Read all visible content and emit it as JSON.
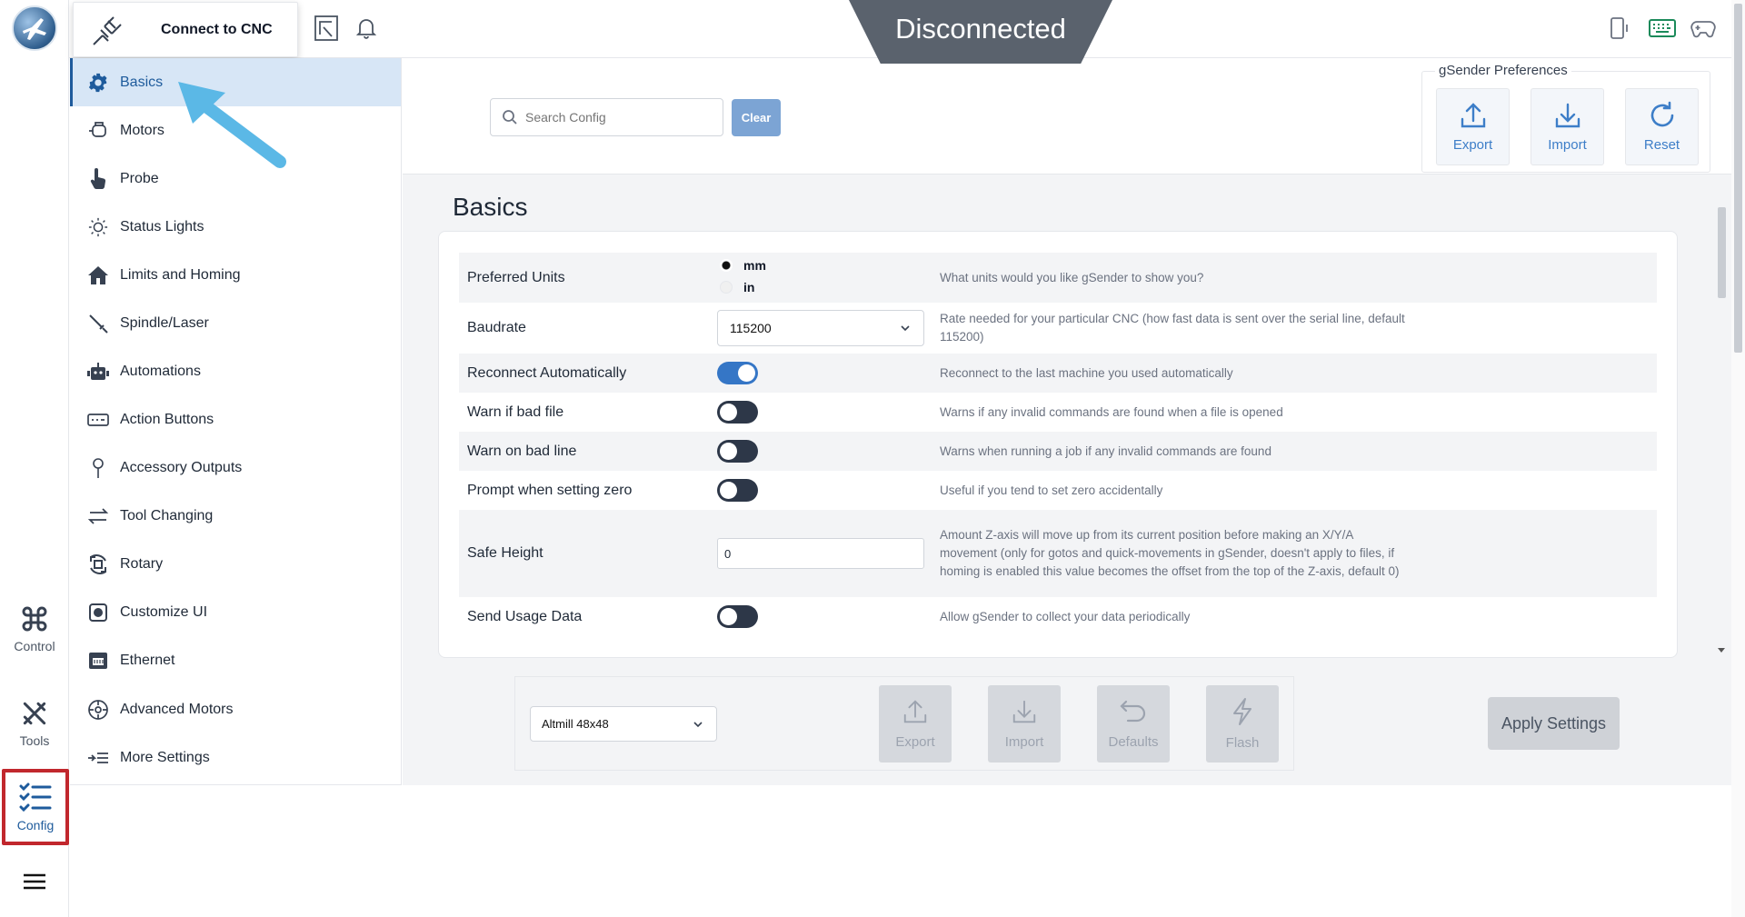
{
  "topbar": {
    "connect_label": "Connect to CNC",
    "status": "Disconnected"
  },
  "rail": {
    "control": "Control",
    "tools": "Tools",
    "config": "Config"
  },
  "sidebar": {
    "items": [
      {
        "label": "Basics",
        "icon": "gear-icon",
        "active": true
      },
      {
        "label": "Motors",
        "icon": "motor-icon"
      },
      {
        "label": "Probe",
        "icon": "hand-pointer-icon"
      },
      {
        "label": "Status Lights",
        "icon": "sun-icon"
      },
      {
        "label": "Limits and Homing",
        "icon": "home-icon"
      },
      {
        "label": "Spindle/Laser",
        "icon": "spindle-icon"
      },
      {
        "label": "Automations",
        "icon": "robot-icon"
      },
      {
        "label": "Action Buttons",
        "icon": "keyboard-icon"
      },
      {
        "label": "Accessory Outputs",
        "icon": "pin-icon"
      },
      {
        "label": "Tool Changing",
        "icon": "swap-icon"
      },
      {
        "label": "Rotary",
        "icon": "rotary-icon"
      },
      {
        "label": "Customize UI",
        "icon": "customize-icon"
      },
      {
        "label": "Ethernet",
        "icon": "ethernet-icon"
      },
      {
        "label": "Advanced Motors",
        "icon": "advanced-motor-icon"
      },
      {
        "label": "More Settings",
        "icon": "more-settings-icon"
      }
    ]
  },
  "search": {
    "placeholder": "Search Config",
    "clear_label": "Clear"
  },
  "preferences": {
    "legend": "gSender Preferences",
    "export": "Export",
    "import": "Import",
    "reset": "Reset"
  },
  "basics": {
    "title": "Basics",
    "preferred_units": {
      "label": "Preferred Units",
      "option_mm": "mm",
      "option_in": "in",
      "selected": "mm",
      "desc": "What units would you like gSender to show you?"
    },
    "baudrate": {
      "label": "Baudrate",
      "value": "115200",
      "desc": "Rate needed for your particular CNC (how fast data is sent over the serial line, default 115200)"
    },
    "reconnect": {
      "label": "Reconnect Automatically",
      "on": true,
      "desc": "Reconnect to the last machine you used automatically"
    },
    "warn_bad_file": {
      "label": "Warn if bad file",
      "on": false,
      "desc": "Warns if any invalid commands are found when a file is opened"
    },
    "warn_bad_line": {
      "label": "Warn on bad line",
      "on": false,
      "desc": "Warns when running a job if any invalid commands are found"
    },
    "prompt_zero": {
      "label": "Prompt when setting zero",
      "on": false,
      "desc": "Useful if you tend to set zero accidentally"
    },
    "safe_height": {
      "label": "Safe Height",
      "value": "0",
      "desc": "Amount Z-axis will move up from its current position before making an X/Y/A movement (only for gotos and quick-movements in gSender, doesn't apply to files, if homing is enabled this value becomes the offset from the top of the Z-axis, default 0)"
    },
    "usage_data": {
      "label": "Send Usage Data",
      "on": false,
      "desc": "Allow gSender to collect your data periodically"
    }
  },
  "firmware": {
    "machine": "Altmill 48x48",
    "export": "Export",
    "import": "Import",
    "defaults": "Defaults",
    "flash": "Flash",
    "apply": "Apply Settings"
  },
  "colors": {
    "accent": "#1e5b9c",
    "status_bg": "#5a626d",
    "highlight_red": "#c1272d",
    "arrow": "#5bb8e6"
  }
}
